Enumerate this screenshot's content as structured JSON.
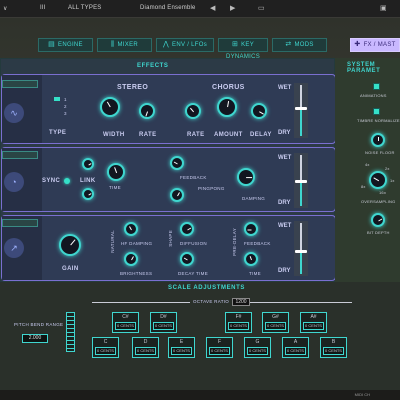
{
  "topbar": {
    "version": "III",
    "category": "ALL TYPES",
    "preset": "Diamond Ensemble"
  },
  "tabs": [
    {
      "label": "ENGINE",
      "icon": "engine-icon"
    },
    {
      "label": "MIXER",
      "icon": "mixer-icon"
    },
    {
      "label": "ENV / LFOs",
      "icon": "env-icon"
    },
    {
      "label": "KEY DYNAMICS",
      "icon": "keys-icon"
    },
    {
      "label": "MODS",
      "icon": "mods-icon"
    },
    {
      "label": "FX / MAST",
      "icon": "fx-icon",
      "active": true
    }
  ],
  "effects": {
    "title": "EFFECTS",
    "rows": [
      {
        "dropdown": "",
        "labels": {
          "type": "TYPE",
          "stereo": "STEREO",
          "width": "WIDTH",
          "rate": "RATE",
          "chorus": "CHORUS",
          "crate": "RATE",
          "amount": "AMOUNT",
          "delay": "DELAY"
        },
        "type_options": [
          "1",
          "2",
          "3"
        ],
        "wet": "WET",
        "dry": "DRY"
      },
      {
        "dropdown": "",
        "labels": {
          "sync": "SYNC",
          "link": "LINK",
          "time": "TIME",
          "feedback": "FEEDBACK",
          "pingpong": "PINGPONG",
          "damping": "DAMPING"
        },
        "wet": "WET",
        "dry": "DRY"
      },
      {
        "dropdown": "",
        "labels": {
          "gain": "GAIN",
          "natural": "NATURAL",
          "hf_damping": "HF DAMPING",
          "brightness": "BRIGHTNESS",
          "shape": "SHAPE",
          "diffusion": "DIFFUSION",
          "decay_time": "DECAY TIME",
          "predelay": "PRE-DELAY",
          "feedback": "FEEDBACK",
          "time": "TIME"
        },
        "wet": "WET",
        "dry": "DRY"
      }
    ]
  },
  "system": {
    "title": "SYSTEM PARAMET",
    "items": [
      "ANIMATIONS",
      "TIMBRE NORMALIZE",
      "NOISE FLOOR",
      "OVERSAMPLING",
      "BIT DEPTH"
    ],
    "oversampling_values": [
      "4x",
      "2x",
      "1x",
      "8x",
      "16x"
    ]
  },
  "scale": {
    "title": "SCALE ADJUSTMENTS",
    "octave_ratio_label": "OCTAVE RATIO",
    "octave_ratio": "1200",
    "pitch_bend_label": "PITCH BEND RANGE",
    "pitch_bend": "2.000",
    "sharps": [
      {
        "note": "C#",
        "cents": "0 CENTS"
      },
      {
        "note": "D#",
        "cents": "0 CENTS"
      },
      {
        "note": "F#",
        "cents": "0 CENTS"
      },
      {
        "note": "G#",
        "cents": "0 CENTS"
      },
      {
        "note": "A#",
        "cents": "0 CENTS"
      }
    ],
    "naturals": [
      {
        "note": "C",
        "cents": "0 CENTS"
      },
      {
        "note": "D",
        "cents": "0 CENTS"
      },
      {
        "note": "E",
        "cents": "0 CENTS"
      },
      {
        "note": "F",
        "cents": "0 CENTS"
      },
      {
        "note": "G",
        "cents": "0 CENTS"
      },
      {
        "note": "A",
        "cents": "0 CENTS"
      },
      {
        "note": "B",
        "cents": "0 CENTS"
      }
    ]
  },
  "bottombar": {
    "cpu": "MIDI CH"
  }
}
